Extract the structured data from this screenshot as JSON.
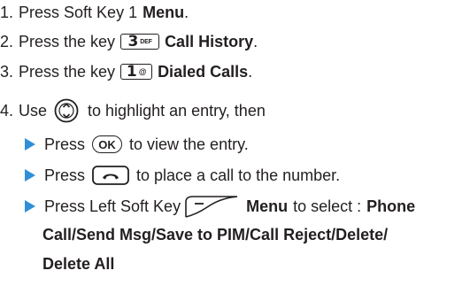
{
  "steps": [
    {
      "num": "1.",
      "text": "Press Soft Key 1",
      "bold": "Menu",
      "end": "."
    },
    {
      "num": "2.",
      "text": "Press the key",
      "key_big": "3",
      "key_small": "DEF",
      "bold": "Call History",
      "end": "."
    },
    {
      "num": "3.",
      "text": "Press the key",
      "key_big": "1",
      "key_small": "@",
      "bold": "Dialed Calls",
      "end": "."
    },
    {
      "num": "4.",
      "text": "Use",
      "after": "to highlight an entry, then"
    }
  ],
  "bullets": [
    {
      "before": "Press",
      "ok_label": "OK",
      "after": "to view the entry."
    },
    {
      "before": "Press",
      "after": "to place a call to the number."
    },
    {
      "before": "Press Left Soft Key",
      "bold": "Menu",
      "mid": "to select :",
      "bold2": "Phone",
      "line2": "Call/Send Msg/Save to PIM/Call Reject/Delete/",
      "line3": "Delete All"
    }
  ],
  "colors": {
    "text": "#231f20",
    "bullet": "#2f8fd8"
  },
  "icons": {
    "nav": "nav-key-icon",
    "send": "send-key-icon",
    "softkey": "left-soft-key-icon"
  }
}
